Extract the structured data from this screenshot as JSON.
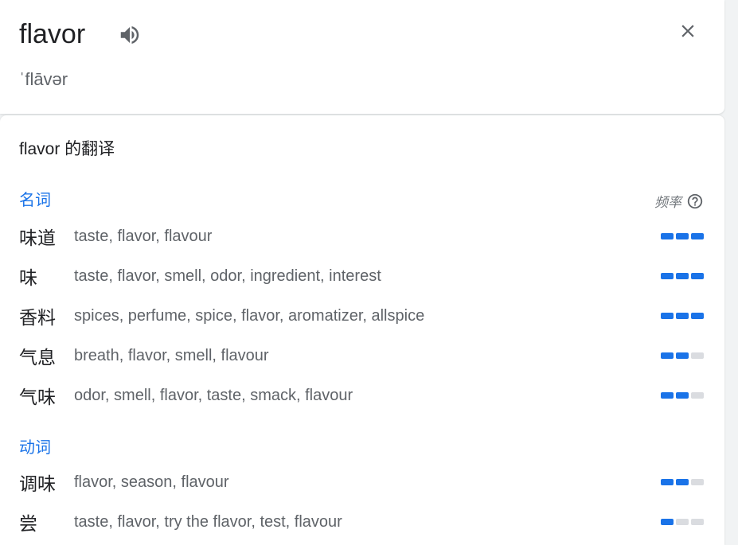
{
  "header": {
    "word": "flavor",
    "phonetic": "ˈflāvər",
    "speaker_icon": "volume-up-icon",
    "close_icon": "close-icon"
  },
  "translations": {
    "title": "flavor 的翻译",
    "frequency_label": "频率",
    "help_icon": "help-circle-icon",
    "accent_color": "#1a73e8",
    "groups": [
      {
        "pos": "名词",
        "rows": [
          {
            "term": "味道",
            "synonyms": "taste, flavor, flavour",
            "frequency": 3
          },
          {
            "term": "味",
            "synonyms": "taste, flavor, smell, odor, ingredient, interest",
            "frequency": 3
          },
          {
            "term": "香料",
            "synonyms": "spices, perfume, spice, flavor, aromatizer, allspice",
            "frequency": 3
          },
          {
            "term": "气息",
            "synonyms": "breath, flavor, smell, flavour",
            "frequency": 2
          },
          {
            "term": "气味",
            "synonyms": "odor, smell, flavor, taste, smack, flavour",
            "frequency": 2
          }
        ]
      },
      {
        "pos": "动词",
        "rows": [
          {
            "term": "调味",
            "synonyms": "flavor, season, flavour",
            "frequency": 2
          },
          {
            "term": "尝",
            "synonyms": "taste, flavor, try the flavor, test, flavour",
            "frequency": 1
          }
        ]
      }
    ]
  }
}
